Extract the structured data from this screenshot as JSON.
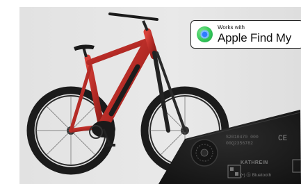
{
  "badge": {
    "top_text": "Works with",
    "main_text": "Apple Find My",
    "icon": "find-my-icon"
  },
  "device": {
    "serial_line1": "S2010470 000",
    "serial_line2": "00Q2356782",
    "ce_mark": "CE",
    "brand": "KATHREIN",
    "footer": "(•) ⓑ Bluetooth"
  },
  "colors": {
    "frame_red": "#b52b26",
    "device_black": "#1b1b1b",
    "background": "#e5e5e5"
  }
}
